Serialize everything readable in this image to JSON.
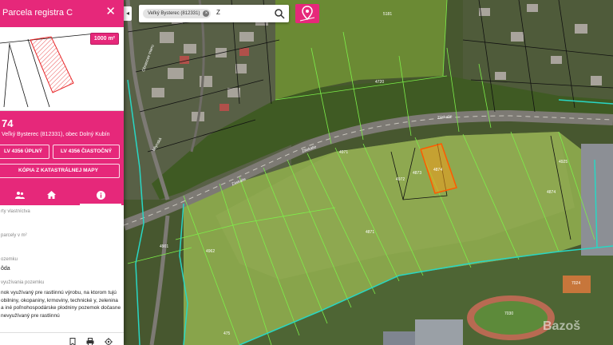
{
  "panel": {
    "title": "Parcela registra C",
    "close_label": "✕",
    "area_badge": "1000 m²",
    "parcel_number": "74",
    "location": "Veľký Bysterec (812331), obec Dolný Kubín",
    "buttons": {
      "lv_full": "LV 4356 ÚPLNÝ",
      "lv_partial": "LV 4356 ČIASTOČNÝ",
      "copy_map": "KÓPIA Z KATASTRÁLNEJ MAPY"
    },
    "tabs": [
      {
        "icon": "people-icon"
      },
      {
        "icon": "home-icon"
      },
      {
        "icon": "info-icon"
      }
    ],
    "details": {
      "owners_label": "rty vlastníctva",
      "area_label": "parcely v m²",
      "land_type_label": "ozemku",
      "land_type_value": "ôda",
      "usage_label": "využívania pozemku",
      "usage_text": "nok využívaný pre rastlinnú výrobu, na ktorom tujú obilniny, okopaniny, krmoviny, technické y, zelenina a iné poľnohospodárske plodniny pozemok dočasne nevyužívaný pre rastlinnú"
    },
    "footer_icons": [
      "bookmark-icon",
      "print-icon",
      "locate-icon"
    ]
  },
  "search": {
    "chip_label": "Veľký Bysterec (812331)",
    "query": "Z"
  },
  "map": {
    "road_labels": [
      "Záskalie",
      "Záskalie",
      "Záskalie"
    ],
    "street_labels": [
      "Obrancov mieru",
      "Mlynská"
    ],
    "parcel_labels": [
      "5181",
      "4971",
      "4972",
      "4873",
      "4874",
      "4874",
      "4871",
      "7024",
      "7030",
      "475",
      "4720",
      "4901",
      "4962",
      "4925"
    ],
    "watermark": "Bazoš"
  },
  "colors": {
    "accent": "#e6287a",
    "cadastre_line": "#7df04a",
    "boundary_line": "#28d7c4",
    "selected_parcel": "#f29a1a"
  }
}
